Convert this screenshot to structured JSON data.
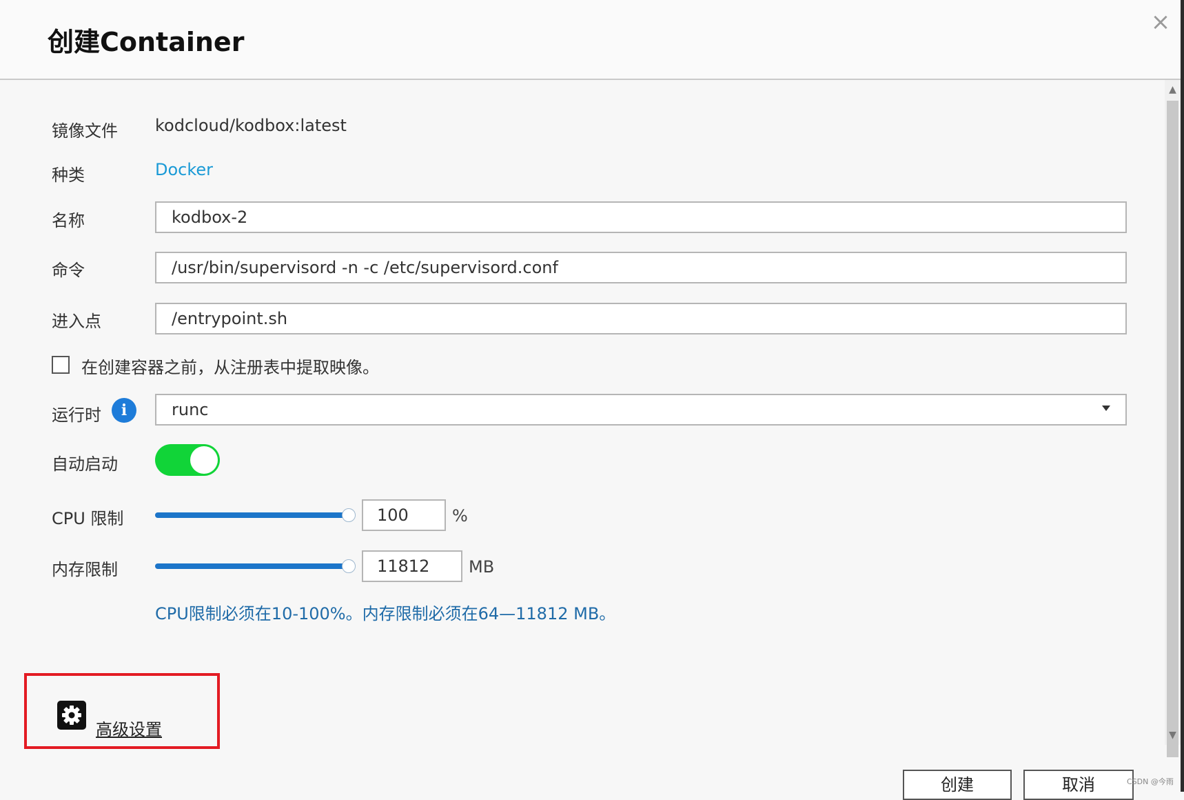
{
  "dialog": {
    "title": "创建Container",
    "close_glyph": "×"
  },
  "form": {
    "image_label": "镜像文件",
    "image_value": "kodcloud/kodbox:latest",
    "type_label": "种类",
    "type_value": "Docker",
    "name_label": "名称",
    "name_value": "kodbox-2",
    "command_label": "命令",
    "command_value": "/usr/bin/supervisord -n -c /etc/supervisord.conf",
    "entrypoint_label": "进入点",
    "entrypoint_value": "/entrypoint.sh",
    "pull_checkbox_label": "在创建容器之前，从注册表中提取映像。",
    "pull_checked": false,
    "runtime_label": "运行时",
    "runtime_value": "runc",
    "autostart_label": "自动启动",
    "autostart_on": true,
    "cpu_label": "CPU 限制",
    "cpu_value": "100",
    "cpu_unit": "%",
    "cpu_level": 1.0,
    "memory_label": "内存限制",
    "memory_value": "11812",
    "memory_unit": "MB",
    "memory_level": 1.0,
    "limit_hint": "CPU限制必须在10-100%。内存限制必须在64—11812 MB。"
  },
  "advanced": {
    "label": "高级设置",
    "icon": "gear-icon"
  },
  "footer": {
    "create_label": "创建",
    "cancel_label": "取消"
  },
  "watermark": "CSDN @今雨",
  "colors": {
    "link": "#1a9ad6",
    "toggle_on": "#11d438",
    "slider_fill": "#1c75c9",
    "highlight_box": "#e31b23",
    "info": "#1e7cd9"
  }
}
